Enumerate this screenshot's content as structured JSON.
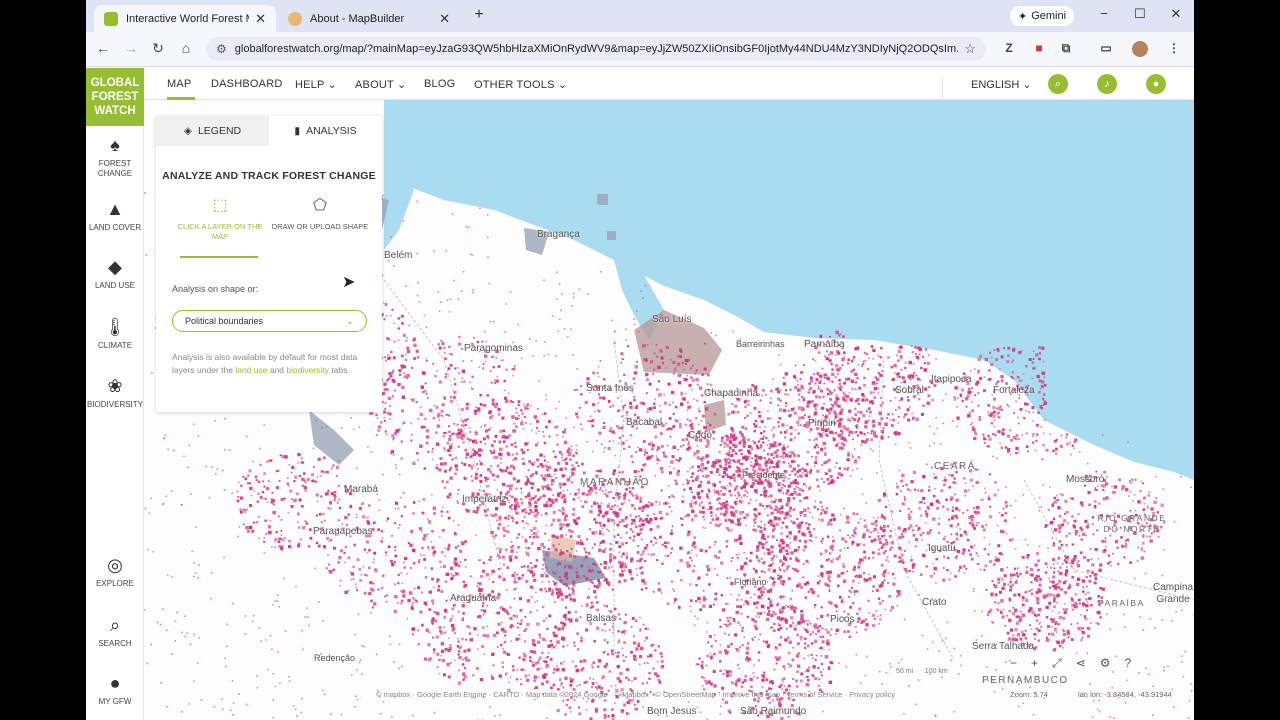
{
  "browser": {
    "tabs": [
      {
        "title": "Interactive World Forest Map &",
        "active": true,
        "color": "#97be32"
      },
      {
        "title": "About - MapBuilder",
        "active": false,
        "color": "#e7b873"
      }
    ],
    "new_tab": "+",
    "gemini": "Gemini",
    "url": "globalforestwatch.org/map/?mainMap=eyJzaG93QW5hbHlzaXMiOnRydWV9&map=eyJjZW50ZXIiOnsibGF0IjotMy44NDU4MzY3NDIyNjQ2ODQsIm...",
    "controls": {
      "minimize": "−",
      "maximize": "☐",
      "close": "✕"
    }
  },
  "header": {
    "logo_lines": [
      "GLOBAL",
      "FOREST",
      "WATCH"
    ],
    "nav": [
      "MAP",
      "DASHBOARD",
      "HELP",
      "ABOUT",
      "BLOG",
      "OTHER TOOLS"
    ],
    "language": "ENGLISH"
  },
  "sidebar": {
    "items": [
      {
        "label": "FOREST CHANGE",
        "icon": "tree-icon"
      },
      {
        "label": "LAND COVER",
        "icon": "land-cover-icon"
      },
      {
        "label": "LAND USE",
        "icon": "land-use-icon"
      },
      {
        "label": "CLIMATE",
        "icon": "thermometer-icon"
      },
      {
        "label": "BIODIVERSITY",
        "icon": "paw-icon"
      }
    ],
    "bottom": [
      {
        "label": "EXPLORE",
        "icon": "compass-icon"
      },
      {
        "label": "SEARCH",
        "icon": "search-icon"
      },
      {
        "label": "MY GFW",
        "icon": "user-icon"
      }
    ]
  },
  "panel": {
    "tab_legend": "LEGEND",
    "tab_analysis": "ANALYSIS",
    "title": "ANALYZE AND TRACK FOREST CHANGE",
    "option_click": "CLICK A LAYER ON THE MAP",
    "option_draw": "DRAW OR UPLOAD SHAPE",
    "shape_label": "Analysis on shape or:",
    "select_value": "Political boundaries",
    "note_pre": "Analysis is also available by default for most data layers under the",
    "note_link1": "land use",
    "note_mid": "and",
    "note_link2": "biodiversity",
    "note_post": "tabs."
  },
  "map": {
    "labels": [
      "Bragança",
      "Belém",
      "São Luís",
      "Barreirinhas",
      "Parnaíba",
      "Paragominas",
      "Santa Inês",
      "Chapadinha",
      "Sobral",
      "Itapipoca",
      "Fortaleza",
      "Bacabal",
      "Codó",
      "Piripiri",
      "MARANHÃO",
      "CEARÁ",
      "Marabá",
      "Imperatriz",
      "Presidente",
      "Mossoró",
      "RIO GRANDE DO NORTE",
      "Parauapebas",
      "Iguatu",
      "Araguaína",
      "Floriano",
      "Picos",
      "Balsas",
      "Crato",
      "Campina Grande",
      "PARAÍBA",
      "Redenção",
      "Serra Talhada",
      "PERNAMBUCO",
      "Bom Jesus",
      "São Raimundo"
    ],
    "footer": "© mapbox · Google Earth Engine · CARTO · Map data ©2024 Google · © Mapbox · © OpenStreetMap · Improve this map · Terms of Service · Privacy policy",
    "zoom": "Zoom: 5.74",
    "latlon": "lat, lon: -3.84584, -43.91944",
    "scale": [
      "50 mi",
      "100 km"
    ]
  },
  "colors": {
    "accent": "#97be32",
    "ocean": "#a9dcf0",
    "loss": "#d0357f"
  }
}
